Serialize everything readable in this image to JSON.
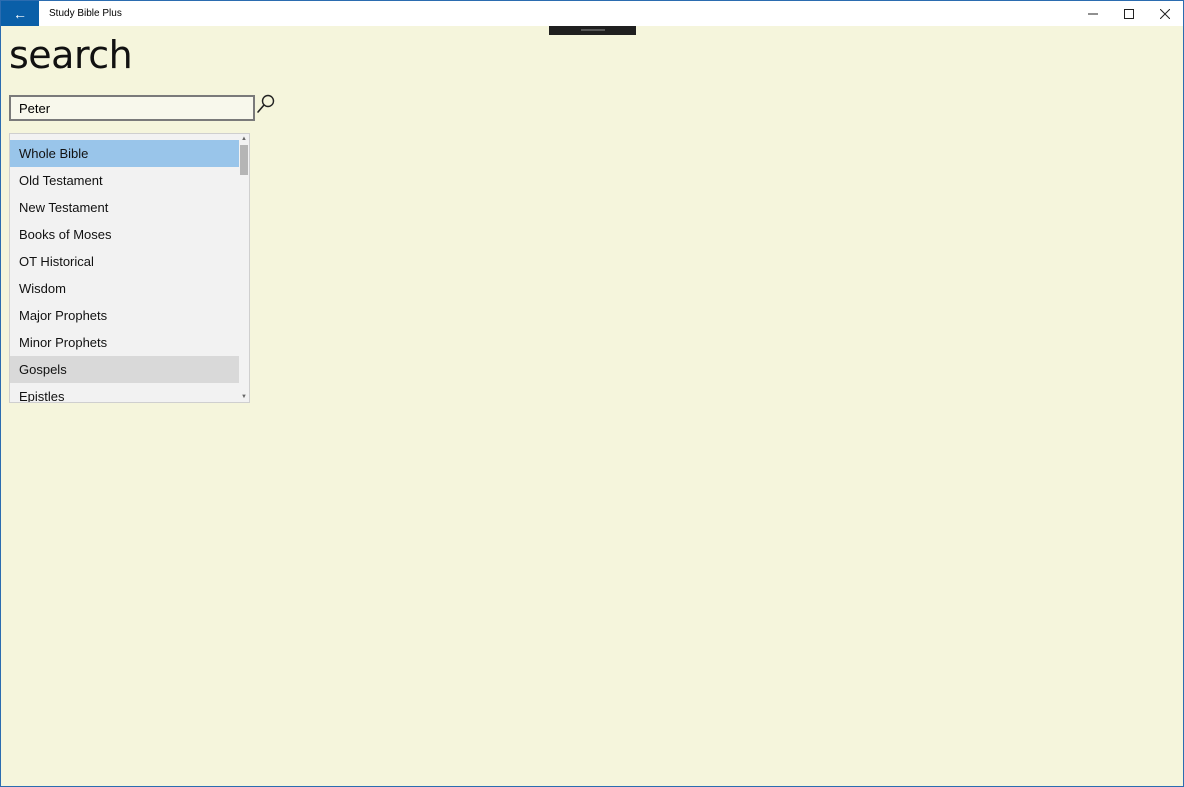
{
  "window": {
    "title": "Study Bible Plus",
    "back_glyph": "←",
    "minimize_glyph": "—",
    "maximize_glyph": "☐",
    "close_glyph": "✕"
  },
  "page": {
    "title": "search"
  },
  "search": {
    "value": "Peter",
    "icon": "search-icon"
  },
  "scope_list": {
    "items": [
      {
        "label": "Whole Bible",
        "state": "selected"
      },
      {
        "label": "Old Testament",
        "state": "normal"
      },
      {
        "label": "New Testament",
        "state": "normal"
      },
      {
        "label": "Books of Moses",
        "state": "normal"
      },
      {
        "label": "OT Historical",
        "state": "normal"
      },
      {
        "label": "Wisdom",
        "state": "normal"
      },
      {
        "label": "Major Prophets",
        "state": "normal"
      },
      {
        "label": "Minor Prophets",
        "state": "normal"
      },
      {
        "label": "Gospels",
        "state": "hovered"
      },
      {
        "label": "Epistles",
        "state": "normal"
      }
    ]
  },
  "colors": {
    "background": "#f5f5dc",
    "accent": "#0a5fa8",
    "selected": "#99c5ea",
    "hover": "#d9d9d9"
  }
}
